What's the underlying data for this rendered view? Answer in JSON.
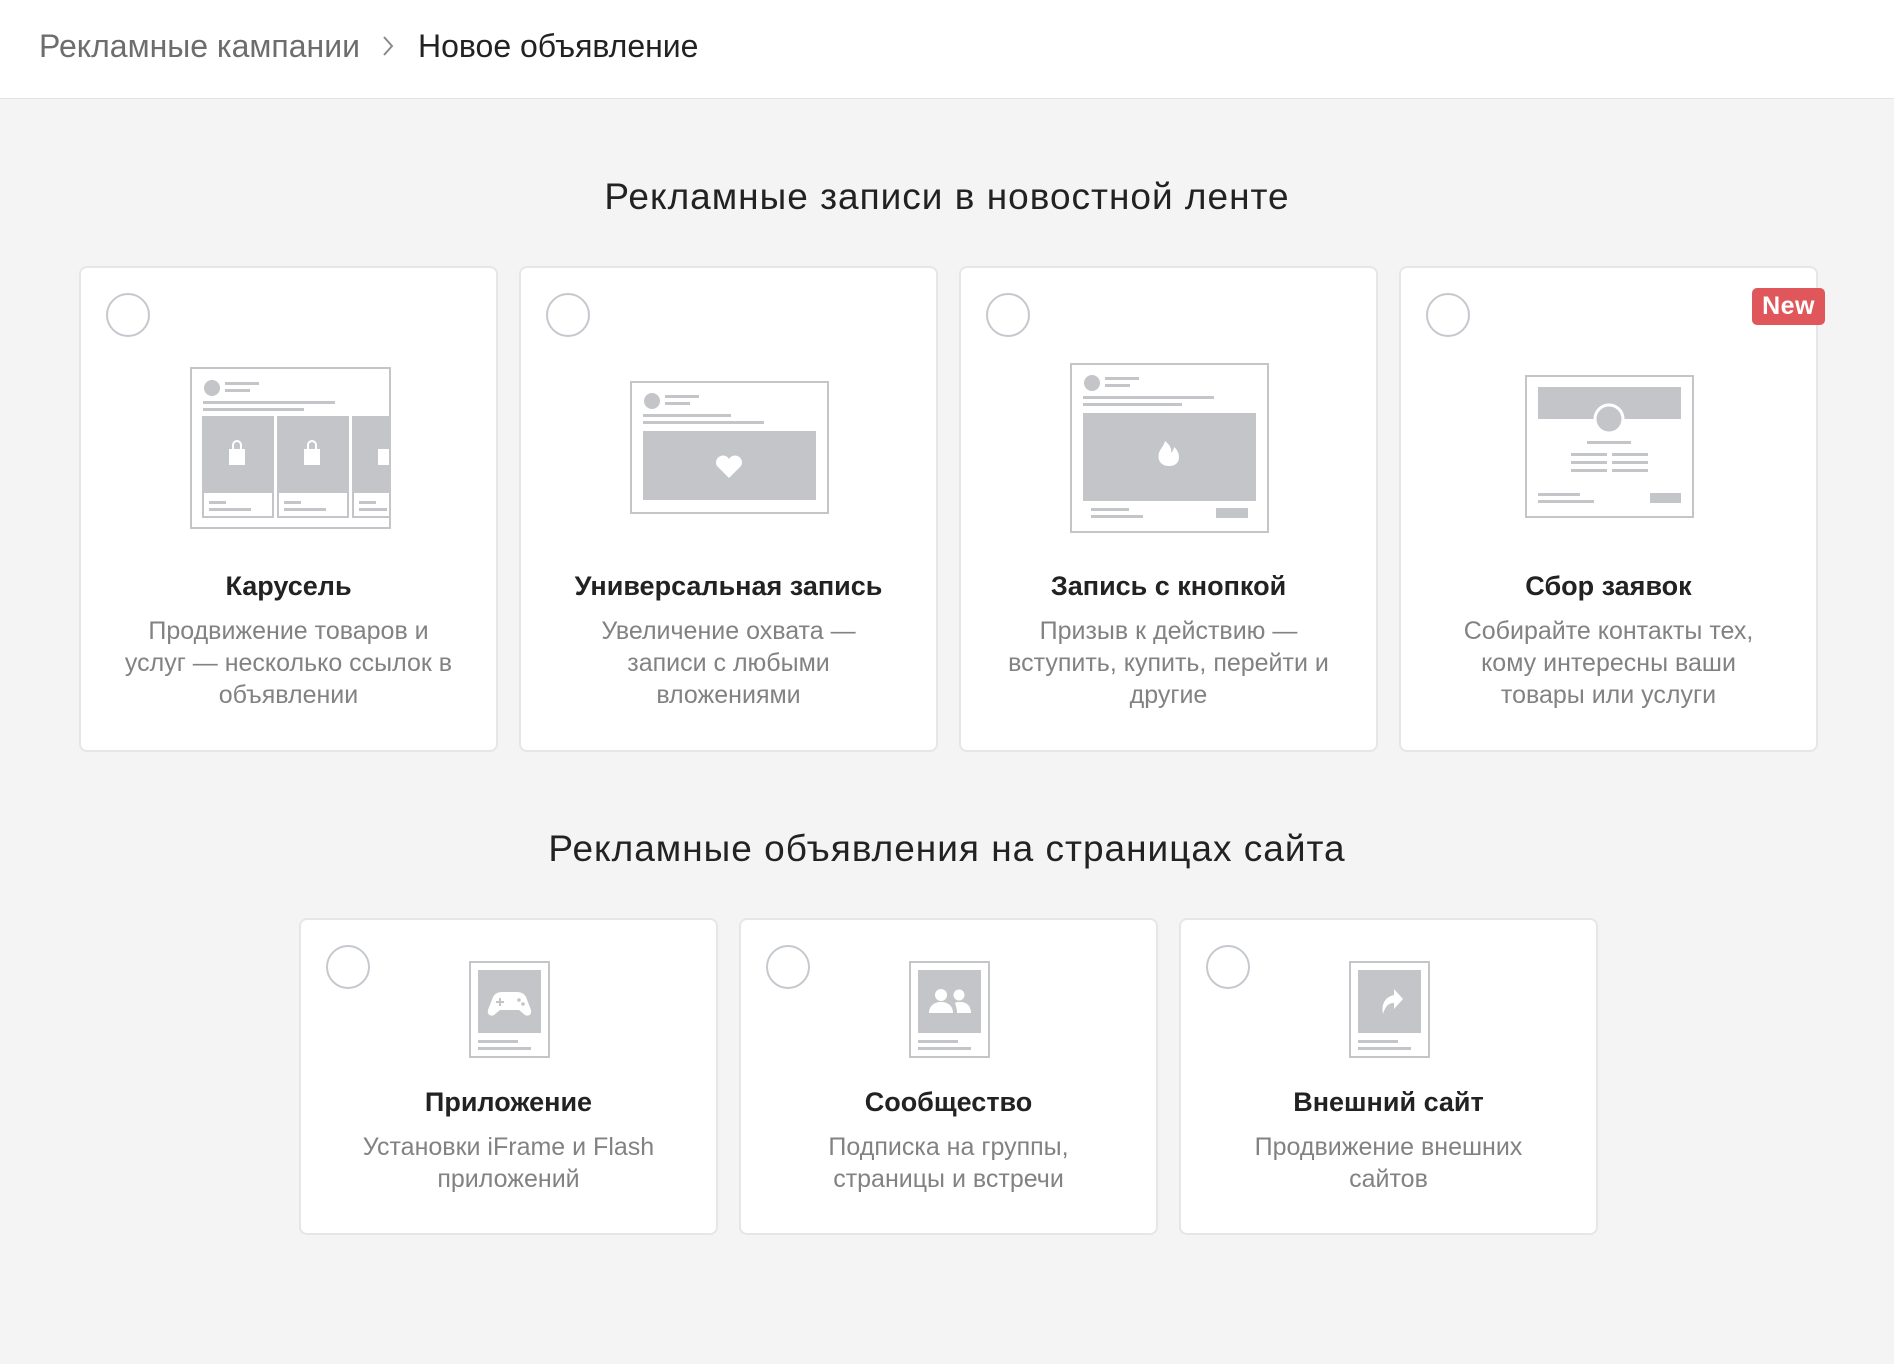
{
  "breadcrumb": {
    "parent": "Рекламные кампании",
    "current": "Новое объявление"
  },
  "sections": [
    {
      "title": "Рекламные записи в новостной ленте",
      "cards": [
        {
          "title": "Карусель",
          "description": "Продвижение товаров и услуг — несколько ссылок в объявлении",
          "icon": "carousel-icon",
          "selected": false
        },
        {
          "title": "Универсальная запись",
          "description": "Увеличение охвата — записи с любыми вложениями",
          "icon": "universal-post-icon",
          "selected": false
        },
        {
          "title": "Запись с кнопкой",
          "description": "Призыв к действию — вступить, купить, перейти и другие",
          "icon": "button-post-icon",
          "selected": false
        },
        {
          "title": "Сбор заявок",
          "description": "Собирайте контакты тех, кому интересны ваши товары или услуги",
          "icon": "lead-form-icon",
          "selected": false,
          "badge": "New"
        }
      ]
    },
    {
      "title": "Рекламные объявления на страницах сайта",
      "cards": [
        {
          "title": "Приложение",
          "description": "Установки iFrame и Flash приложений",
          "icon": "gamepad-icon",
          "selected": false
        },
        {
          "title": "Сообщество",
          "description": "Подписка на группы, страницы и встречи",
          "icon": "community-icon",
          "selected": false
        },
        {
          "title": "Внешний сайт",
          "description": "Продвижение внешних сайтов",
          "icon": "external-link-icon",
          "selected": false
        }
      ]
    }
  ],
  "colors": {
    "background": "#f4f4f4",
    "card": "#ffffff",
    "badge": "#e0575b",
    "placeholder": "#c4c5c9"
  }
}
